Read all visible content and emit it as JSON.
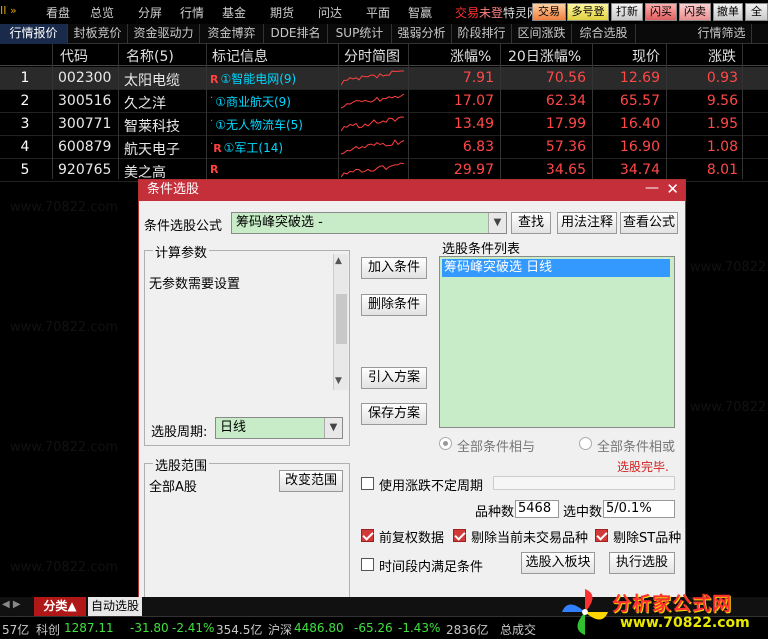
{
  "menubar": {
    "brand": "II »",
    "items": [
      "看盘",
      "总览",
      "分屏",
      "行情",
      "基金",
      "期货",
      "问达",
      "平面",
      "智赢"
    ],
    "trade_label": "交易",
    "trade_status": "未登",
    "trade_extra": "特灵网",
    "buttons": [
      "交易",
      "多号登",
      "打新",
      "闪买",
      "闪卖",
      "撤单",
      "全"
    ]
  },
  "tabs": [
    "行情报价",
    "封板竞价",
    "资金驱动力",
    "资金博弈",
    "DDE排名",
    "SUP统计",
    "强弱分析",
    "阶段排行",
    "区间涨跌",
    "综合选股",
    "行情筛选"
  ],
  "table": {
    "headers": [
      "",
      "代码",
      "名称(5)",
      "标记信息",
      "分时简图",
      "涨幅%",
      "20日涨幅%",
      "现价",
      "涨跌"
    ],
    "rows": [
      {
        "n": "1",
        "code": "002300",
        "name": "太阳电缆",
        "tag": "①智能电网(9)",
        "r": "R",
        "dot": "",
        "chg": "7.91",
        "chg20": "70.56",
        "price": "12.69",
        "diff": "0.93"
      },
      {
        "n": "2",
        "code": "300516",
        "name": "久之洋",
        "tag": "①商业航天(9)",
        "r": "",
        "dot": "·",
        "chg": "17.07",
        "chg20": "62.34",
        "price": "65.57",
        "diff": "9.56"
      },
      {
        "n": "3",
        "code": "300771",
        "name": "智莱科技",
        "tag": "①无人物流车(5)",
        "r": "",
        "dot": "·",
        "chg": "13.49",
        "chg20": "17.99",
        "price": "16.40",
        "diff": "1.95"
      },
      {
        "n": "4",
        "code": "600879",
        "name": "航天电子",
        "tag": "①军工(14)",
        "r": "R",
        "dot": "·",
        "chg": "6.83",
        "chg20": "57.36",
        "price": "16.90",
        "diff": "1.08"
      },
      {
        "n": "5",
        "code": "920765",
        "name": "美之高",
        "tag": "",
        "r": "R",
        "dot": "",
        "chg": "29.97",
        "chg20": "34.65",
        "price": "34.74",
        "diff": "8.01"
      }
    ]
  },
  "dialog": {
    "title": "条件选股",
    "formula_label": "条件选股公式",
    "formula_value": "筹码峰突破选  -",
    "btn_find": "查找",
    "btn_usage": "用法注释",
    "btn_view": "查看公式",
    "params_group": "计算参数",
    "params_text": "无参数需要设置",
    "btn_add": "加入条件",
    "btn_delete": "删除条件",
    "list_title": "选股条件列表",
    "list_item": "筹码峰突破选  日线",
    "period_label": "选股周期:",
    "period_value": "日线",
    "btn_import": "引入方案",
    "btn_save": "保存方案",
    "radio_and": "全部条件相与",
    "radio_or": "全部条件相或",
    "status_done": "选股完毕.",
    "range_group": "选股范围",
    "range_value": "全部A股",
    "btn_range": "改变范围",
    "chk_period": "使用涨跌不定周期",
    "count_label": "品种数",
    "count_value": "5468",
    "selected_label": "选中数",
    "selected_value": "5/0.1%",
    "chk_fq": "前复权数据",
    "chk_notrade": "剔除当前未交易品种",
    "chk_st": "剔除ST品种",
    "chk_timespan": "时间段内满足条件",
    "btn_toblock": "选股入板块",
    "btn_execute": "执行选股"
  },
  "bottomtabs": {
    "tab1": "分类▲",
    "tab2": "自动选股"
  },
  "status": {
    "s1": "57亿",
    "s2": "科创",
    "s3": "1287.11",
    "s4": "-31.80",
    "s5": "-2.41%",
    "s6": "354.5亿",
    "s7": "沪深",
    "s8": "4486.80",
    "s9": "-65.26",
    "s10": "-1.43%",
    "s11": "2836亿",
    "s12": "总成交"
  },
  "logo": {
    "title": "分析家公式网",
    "url": "www.70822.com"
  },
  "watermark": "www.70822.com"
}
